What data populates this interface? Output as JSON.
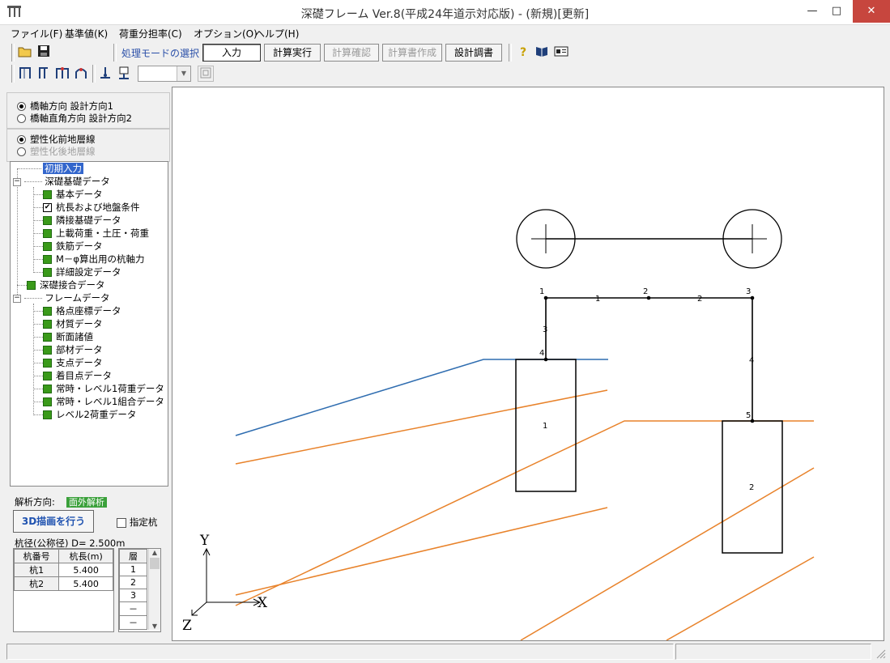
{
  "window": {
    "title": "深礎フレーム Ver.8(平成24年道示対応版) - (新規)[更新]",
    "app_icon": "frame-app-icon",
    "minimize": "—",
    "maximize": "□",
    "close": "✕"
  },
  "menu": [
    {
      "label": "ファイル(F)"
    },
    {
      "label": "基準値(K)"
    },
    {
      "label": "荷重分担率(C)"
    },
    {
      "label": "オプション(O)"
    },
    {
      "label": "ヘルプ(H)"
    }
  ],
  "toolbar1": {
    "mode_label": "処理モードの選択",
    "buttons": [
      "入力",
      "計算実行",
      "計算確認",
      "計算書作成",
      "設計調書"
    ],
    "disabled": [
      "計算確認",
      "計算書作成"
    ],
    "active": "入力"
  },
  "toolbar2": {
    "select_value": ""
  },
  "direction": {
    "options": [
      "橋軸方向 設計方向1",
      "橋軸直角方向 設計方向2"
    ],
    "selected": 0
  },
  "layer": {
    "options": [
      "塑性化前地層線",
      "塑性化後地層線"
    ],
    "selected": 0
  },
  "tree": {
    "root_item": "初期入力",
    "group1": "深礎基礎データ",
    "group1_items": [
      "基本データ",
      "杭長および地盤条件",
      "隣接基礎データ",
      "上載荷重・土圧・荷重",
      "鉄筋データ",
      "M－φ算出用の杭軸力",
      "詳細設定データ"
    ],
    "single": "深礎接合データ",
    "group2": "フレームデータ",
    "group2_items": [
      "格点座標データ",
      "材質データ",
      "断面諸値",
      "部材データ",
      "支点データ",
      "着目点データ",
      "常時・レベル1荷重データ",
      "常時・レベル1組合データ",
      "レベル2荷重データ"
    ]
  },
  "analysis": {
    "label": "解析方向:",
    "value": "面外解析",
    "button_3d": "3D描画を行う",
    "check_label": "指定杭",
    "diameter": "杭径(公称径) D= 2.500m"
  },
  "pile_table": {
    "headers": [
      "杭番号",
      "杭長(m)"
    ],
    "rows": [
      [
        "杭1",
        "5.400"
      ],
      [
        "杭2",
        "5.400"
      ]
    ]
  },
  "layer_table": {
    "header": "層",
    "rows": [
      "1",
      "2",
      "3",
      "－",
      "－"
    ]
  },
  "drawing": {
    "axis_y": "Y",
    "axis_x": "X",
    "axis_z": "Z",
    "node_labels": [
      "1",
      "2",
      "3",
      "4",
      "5"
    ],
    "member_labels": [
      "1",
      "2",
      "3",
      "4"
    ],
    "pile_labels": [
      "1",
      "2"
    ],
    "colors": {
      "frame": "#000000",
      "ground": "#2f6db0",
      "layer": "#e8822a"
    }
  }
}
